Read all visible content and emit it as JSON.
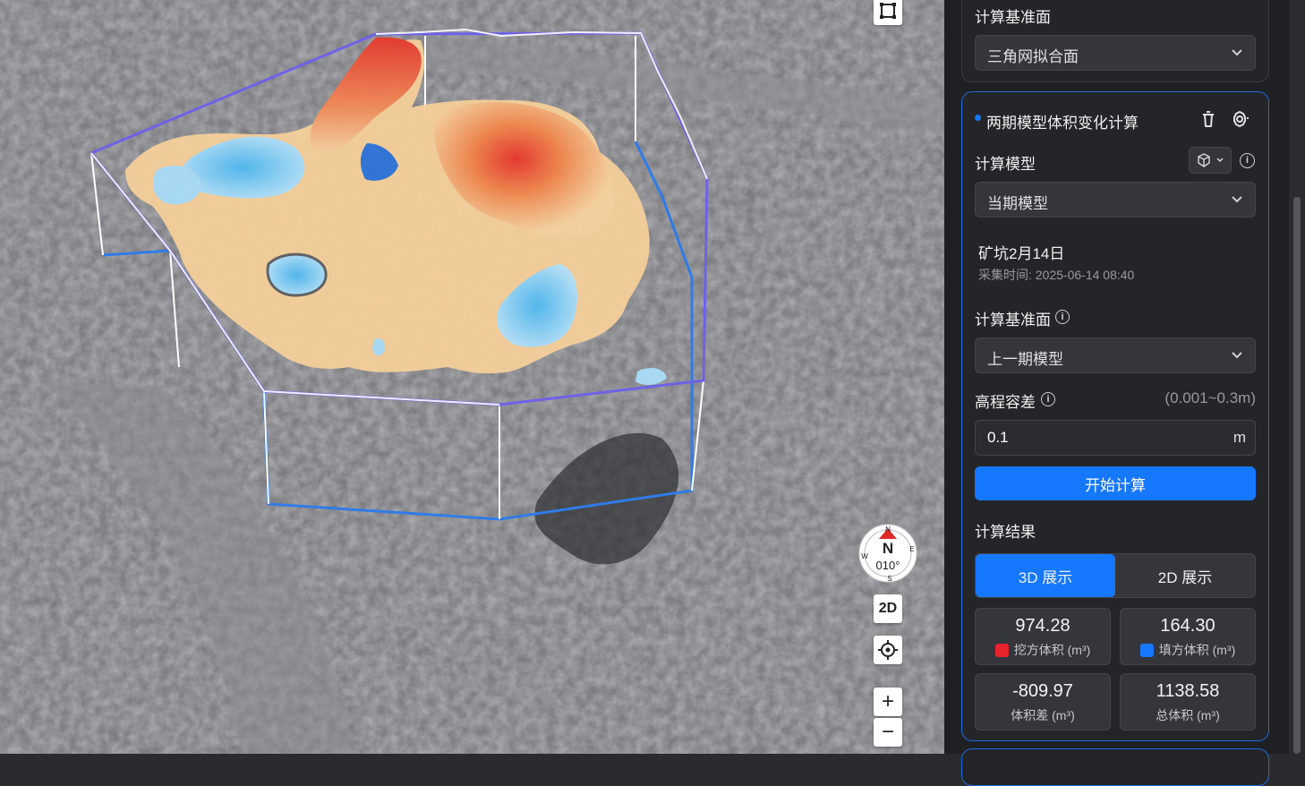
{
  "map": {
    "compass": {
      "north": "N",
      "heading": "010°",
      "e": "E",
      "s": "S",
      "w": "W"
    },
    "view_mode_button": "2D",
    "zoom_in": "+",
    "zoom_out": "−"
  },
  "panel": {
    "prev_card": {
      "label": "计算基准面",
      "select_value": "三角网拟合面"
    },
    "volume_card": {
      "title": "两期模型体积变化计算",
      "model_label": "计算模型",
      "model_select": "当期模型",
      "model_name": "矿坑2月14日",
      "capture_time": "采集时间: 2025-06-14 08:40",
      "base_label": "计算基准面",
      "base_select": "上一期模型",
      "tolerance_label": "高程容差",
      "tolerance_range": "(0.001~0.3m)",
      "tolerance_value": "0.1",
      "tolerance_unit": "m",
      "start_button": "开始计算",
      "result_label": "计算结果",
      "tabs": [
        "3D 展示",
        "2D 展示"
      ],
      "active_tab": "3D 展示",
      "stats": {
        "cut": {
          "value": "974.28",
          "caption": "挖方体积 (m³)",
          "color": "#e8242c"
        },
        "fill": {
          "value": "164.30",
          "caption": "填方体积 (m³)",
          "color": "#1677ff"
        },
        "diff": {
          "value": "-809.97",
          "caption": "体积差 (m³)"
        },
        "total": {
          "value": "1138.58",
          "caption": "总体积 (m³)"
        }
      }
    }
  },
  "colors": {
    "accent": "#1677ff",
    "panel_bg": "#1f2023",
    "card_border_active": "#1c6bd6"
  }
}
